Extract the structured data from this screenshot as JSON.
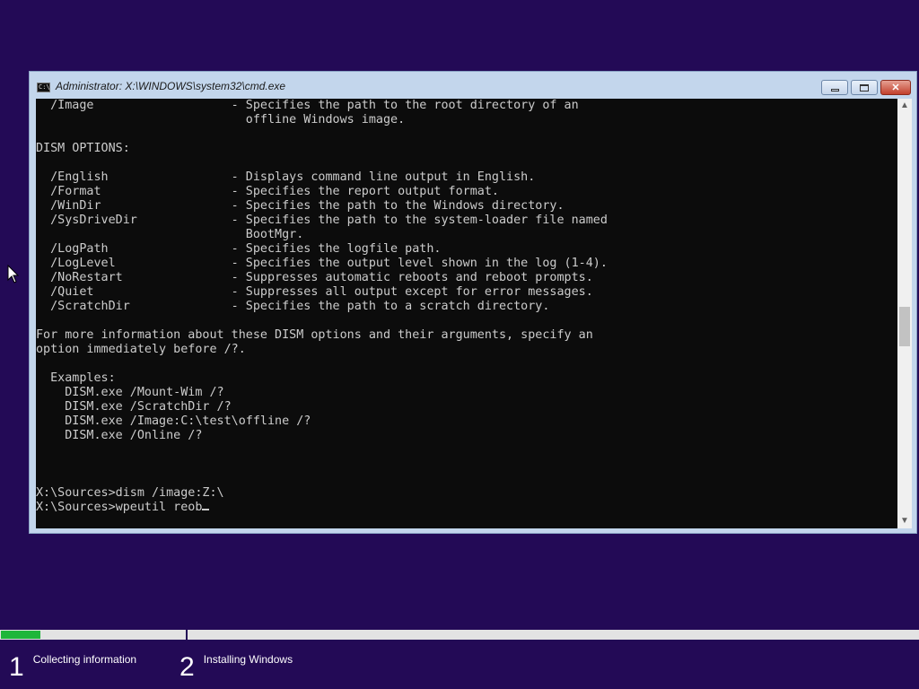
{
  "window": {
    "title": "Administrator: X:\\WINDOWS\\system32\\cmd.exe",
    "controls": {
      "minimize": "minimize",
      "maximize": "maximize",
      "close": "✕"
    }
  },
  "console": {
    "output": "  /Image                   - Specifies the path to the root directory of an\n                             offline Windows image.\n\nDISM OPTIONS:\n\n  /English                 - Displays command line output in English.\n  /Format                  - Specifies the report output format.\n  /WinDir                  - Specifies the path to the Windows directory.\n  /SysDriveDir             - Specifies the path to the system-loader file named\n                             BootMgr.\n  /LogPath                 - Specifies the logfile path.\n  /LogLevel                - Specifies the output level shown in the log (1-4).\n  /NoRestart               - Suppresses automatic reboots and reboot prompts.\n  /Quiet                   - Suppresses all output except for error messages.\n  /ScratchDir              - Specifies the path to a scratch directory.\n\nFor more information about these DISM options and their arguments, specify an\noption immediately before /?.\n\n  Examples:\n    DISM.exe /Mount-Wim /?\n    DISM.exe /ScratchDir /?\n    DISM.exe /Image:C:\\test\\offline /?\n    DISM.exe /Online /?\n\n\n\nX:\\Sources>dism /image:Z:\\\n",
    "prompt": "X:\\Sources>",
    "current_input": "wpeutil reob"
  },
  "setup_progress": {
    "fraction": 0.043,
    "steps": [
      {
        "number": "1",
        "label": "Collecting information"
      },
      {
        "number": "2",
        "label": "Installing Windows"
      }
    ]
  },
  "colors": {
    "desktop_background": "#230a56",
    "console_background": "#0c0c0c",
    "console_text": "#cccccc",
    "progress_green": "#1fb63a"
  }
}
